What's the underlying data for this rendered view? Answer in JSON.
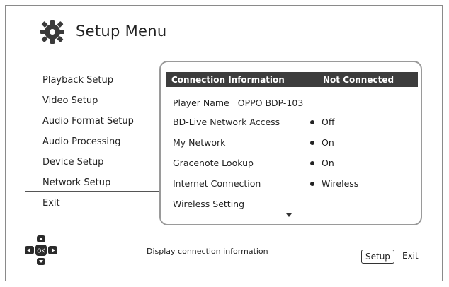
{
  "header": {
    "title": "Setup Menu"
  },
  "sidebar": {
    "items": [
      {
        "label": "Playback Setup"
      },
      {
        "label": "Video Setup"
      },
      {
        "label": "Audio Format Setup"
      },
      {
        "label": "Audio Processing"
      },
      {
        "label": "Device Setup"
      },
      {
        "label": "Network Setup",
        "selected": true
      },
      {
        "label": "Exit"
      }
    ]
  },
  "panel": {
    "header": {
      "label": "Connection Information",
      "value": "Not Connected"
    },
    "player_name": {
      "label": "Player Name",
      "value": "OPPO BDP-103"
    },
    "rows": [
      {
        "label": "BD-Live Network Access",
        "value": "Off"
      },
      {
        "label": "My Network",
        "value": "On"
      },
      {
        "label": "Gracenote Lookup",
        "value": "On"
      },
      {
        "label": "Internet Connection",
        "value": "Wireless"
      },
      {
        "label": "Wireless Setting",
        "value": ""
      }
    ]
  },
  "footer": {
    "help_text": "Display connection information",
    "setup_button": "Setup",
    "exit_label": "Exit",
    "nav_center_label": "OK"
  },
  "icons": {
    "title": "gear-icon",
    "nav": "directional-pad-icon",
    "scroll": "scroll-down-arrow-icon"
  },
  "colors": {
    "header_bar": "#3d3d3d",
    "frame": "#8a8a8a"
  }
}
